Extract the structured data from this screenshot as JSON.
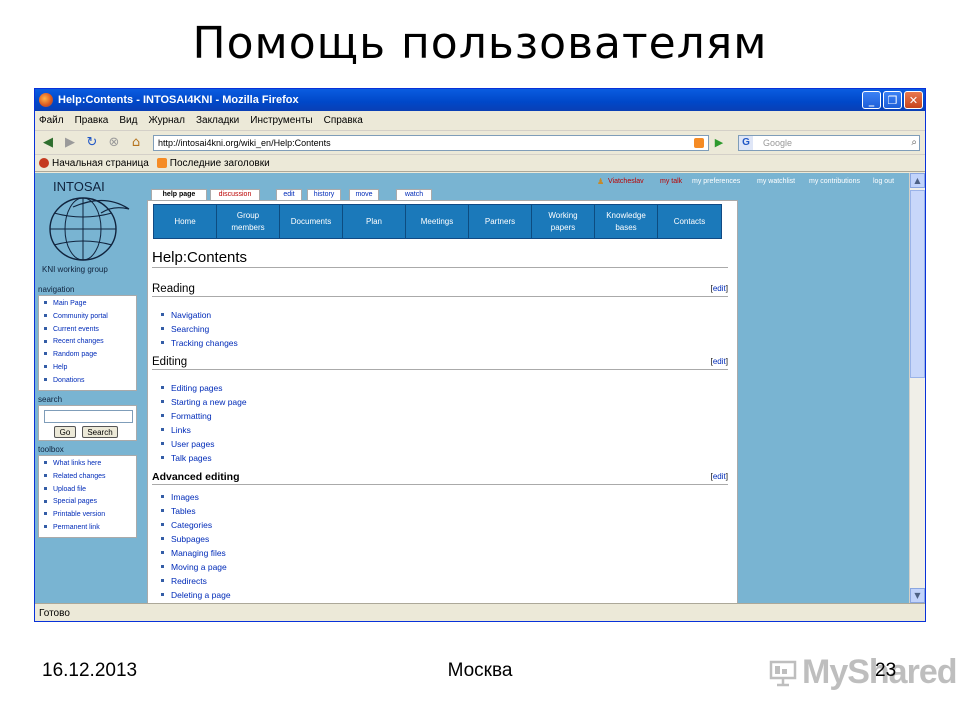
{
  "slide": {
    "title": "Помощь пользователям",
    "date": "16.12.2013",
    "city": "Москва",
    "page_number": "23",
    "watermark": "MyShared"
  },
  "browser": {
    "window_title": "Help:Contents - INTOSAI4KNI - Mozilla Firefox",
    "menu": [
      "Файл",
      "Правка",
      "Вид",
      "Журнал",
      "Закладки",
      "Инструменты",
      "Справка"
    ],
    "url": "http://intosai4kni.org/wiki_en/Help:Contents",
    "search_placeholder": "Google",
    "bookmarks": [
      "Начальная страница",
      "Последние заголовки"
    ],
    "status": "Готово"
  },
  "wiki": {
    "logo_top": "INTOSAI",
    "logo_bottom": "KNI working group",
    "personal": {
      "user": "Viatcheslav",
      "talk": "my talk",
      "preferences": "my preferences",
      "watchlist": "my watchlist",
      "contributions": "my contributions",
      "logout": "log out"
    },
    "tabs": [
      "help page",
      "discussion",
      "edit",
      "history",
      "move",
      "watch"
    ],
    "navigation_title": "navigation",
    "navigation": [
      "Main Page",
      "Community portal",
      "Current events",
      "Recent changes",
      "Random page",
      "Help",
      "Donations"
    ],
    "search_title": "search",
    "search_go": "Go",
    "search_search": "Search",
    "toolbox_title": "toolbox",
    "toolbox": [
      "What links here",
      "Related changes",
      "Upload file",
      "Special pages",
      "Printable version",
      "Permanent link"
    ],
    "topnav": [
      {
        "line1": "Home",
        "line2": ""
      },
      {
        "line1": "Group",
        "line2": "members"
      },
      {
        "line1": "Documents",
        "line2": ""
      },
      {
        "line1": "Plan",
        "line2": ""
      },
      {
        "line1": "Meetings",
        "line2": ""
      },
      {
        "line1": "Partners",
        "line2": ""
      },
      {
        "line1": "Working",
        "line2": "papers"
      },
      {
        "line1": "Knowledge",
        "line2": "bases"
      },
      {
        "line1": "Contacts",
        "line2": ""
      }
    ],
    "page_title": "Help:Contents",
    "edit_label": "edit",
    "sections": [
      {
        "title": "Reading",
        "items": [
          "Navigation",
          "Searching",
          "Tracking changes"
        ]
      },
      {
        "title": "Editing",
        "items": [
          "Editing pages",
          "Starting a new page",
          "Formatting",
          "Links",
          "User pages",
          "Talk pages"
        ]
      },
      {
        "title": "Advanced editing",
        "items": [
          "Images",
          "Tables",
          "Categories",
          "Subpages",
          "Managing files",
          "Moving a page",
          "Redirects",
          "Deleting a page"
        ]
      }
    ]
  }
}
